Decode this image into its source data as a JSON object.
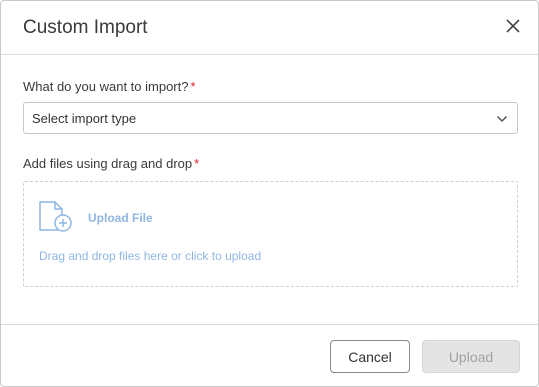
{
  "dialog": {
    "title": "Custom Import",
    "close_icon": "close-icon"
  },
  "import_type": {
    "label": "What do you want to import?",
    "required_marker": "*",
    "selected_value": "Select import type",
    "chevron_icon": "chevron-down-icon"
  },
  "files": {
    "label": "Add files using drag and drop",
    "required_marker": "*",
    "file_icon": "file-add-icon",
    "upload_link": "Upload File",
    "hint": "Drag and drop files here or click to upload"
  },
  "footer": {
    "cancel_label": "Cancel",
    "upload_label": "Upload",
    "upload_enabled": false
  },
  "colors": {
    "required": "#d9222a",
    "link": "#8fb6e3",
    "disabled_bg": "#e4e4e4",
    "disabled_text": "#a3a3a3"
  }
}
